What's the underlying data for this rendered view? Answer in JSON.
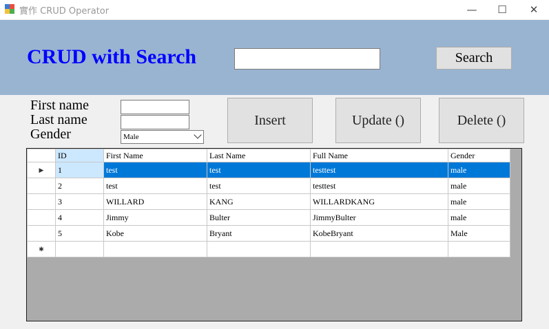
{
  "window": {
    "title": "實作 CRUD Operator",
    "minimize": "—",
    "maximize": "☐",
    "close": "✕"
  },
  "header": {
    "title": "CRUD with Search",
    "search_value": "",
    "search_label": "Search"
  },
  "form": {
    "first_name_label": "First name",
    "last_name_label": "Last name",
    "gender_label": "Gender",
    "first_name_value": "",
    "last_name_value": "",
    "gender_value": "Male"
  },
  "buttons": {
    "insert": "Insert",
    "update": "Update ()",
    "delete": "Delete ()"
  },
  "grid": {
    "columns": [
      "ID",
      "First Name",
      "Last Name",
      "Full Name",
      "Gender"
    ],
    "rows": [
      [
        "1",
        "test",
        "test",
        "testtest",
        "male"
      ],
      [
        "2",
        "test",
        "test",
        "testtest",
        "male"
      ],
      [
        "3",
        "WILLARD",
        "KANG",
        "WILLARDKANG",
        "male"
      ],
      [
        "4",
        "Jimmy",
        "Bulter",
        "JimmyBulter",
        "male"
      ],
      [
        "5",
        "Kobe",
        "Bryant",
        "KobeBryant",
        "Male"
      ]
    ],
    "current_row_marker": "▶",
    "new_row_marker": "✱",
    "selected_row_index": 0
  },
  "colors": {
    "header_bg": "#99b4d1",
    "title_color": "#0000ff",
    "selection": "#0078d7"
  }
}
